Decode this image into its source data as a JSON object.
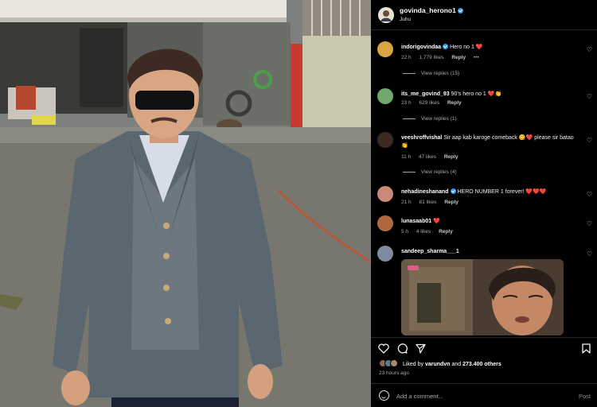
{
  "post": {
    "author": "govinda_herono1",
    "location": "Juhu",
    "more_label": "•••"
  },
  "comments": [
    {
      "user": "indorigovindaa",
      "text": "Hero no 1 ❤️",
      "time": "22 h",
      "likes": "1,779 likes",
      "reply_label": "Reply",
      "more_label": "•••",
      "view_replies": "View replies (15)",
      "verified": true,
      "avatar_color": "#d9a441"
    },
    {
      "user": "its_me_govind_93",
      "text": "90's hero no 1 ❤️👏",
      "time": "23 h",
      "likes": "629 likes",
      "reply_label": "Reply",
      "view_replies": "View replies (1)",
      "verified": false,
      "avatar_color": "#6fa86a"
    },
    {
      "user": "veeshroffvishal",
      "text": "Sir aap kab karoge comeback 😋❤️ please sir batao 👏",
      "time": "11 h",
      "likes": "47 likes",
      "reply_label": "Reply",
      "view_replies": "View replies (4)",
      "verified": false,
      "avatar_color": "#3b2a22"
    },
    {
      "user": "nehadineshanand",
      "text": "HERO NUMBER 1 forever! ❤️❤️❤️",
      "time": "21 h",
      "likes": "81 likes",
      "reply_label": "Reply",
      "verified": true,
      "avatar_color": "#c98a7a"
    },
    {
      "user": "lunasaab01",
      "text": "❤️",
      "time": "5 h",
      "likes": "4 likes",
      "reply_label": "Reply",
      "verified": false,
      "avatar_color": "#b0683e"
    },
    {
      "user": "sandeep_sharma___1",
      "text": "",
      "verified": false,
      "avatar_color": "#7d8aa0"
    }
  ],
  "footer": {
    "liked_by_prefix": "Liked by",
    "liked_by_user": "varundvn",
    "liked_by_and": "and",
    "liked_by_others": "273.400 others",
    "time_ago": "23 hours ago",
    "add_comment_placeholder": "Add a comment...",
    "post_label": "Post"
  },
  "icons": {
    "heart": "heart-icon",
    "comment": "comment-icon",
    "share": "share-icon",
    "save": "bookmark-icon",
    "emoji": "emoji-icon",
    "verified": "verified-badge-icon"
  },
  "colors": {
    "background": "#000000",
    "verified": "#3897f0",
    "heart_red": "#ff3b6b",
    "muted_text": "#a8a8a8"
  }
}
